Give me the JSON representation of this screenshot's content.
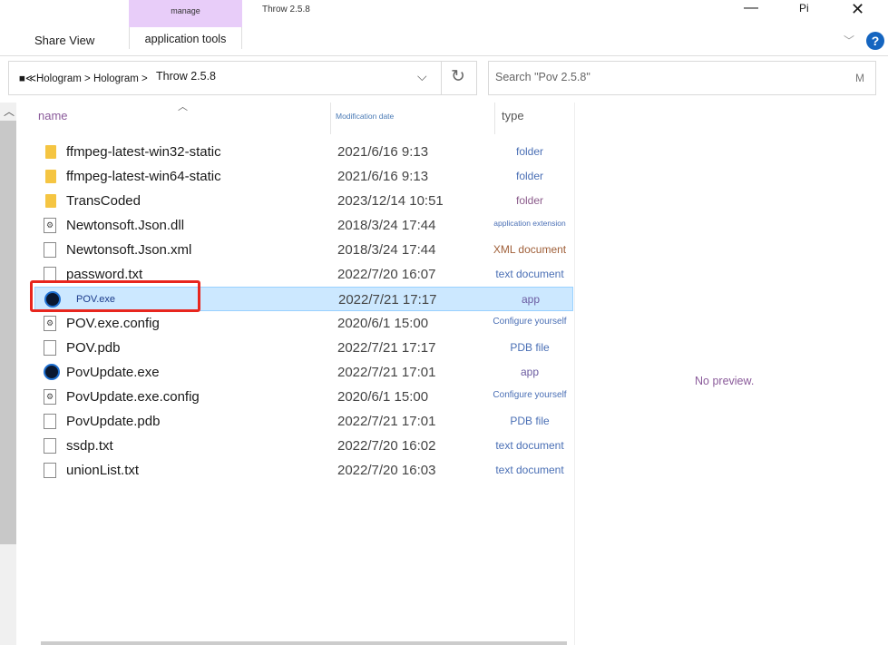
{
  "ribbon": {
    "manage_label": "manage",
    "title": "Throw 2.5.8",
    "share_view_label": "Share View",
    "app_tools_label": "application tools",
    "pi_label": "Pi"
  },
  "address": {
    "path": "■≪Hologram > Hologram >",
    "current": "Throw 2.5.8"
  },
  "search": {
    "placeholder": "Search \"Pov 2.5.8\"",
    "suffix": "M"
  },
  "columns": {
    "name": "name",
    "date": "Modification date",
    "type": "type"
  },
  "files": [
    {
      "name": "ffmpeg-latest-win32-static",
      "date": "2021/6/16 9:13",
      "type": "folder",
      "icon": "folder",
      "type_color": "#4a6fb5"
    },
    {
      "name": "ffmpeg-latest-win64-static",
      "date": "2021/6/16 9:13",
      "type": "folder",
      "icon": "folder",
      "type_color": "#4a6fb5"
    },
    {
      "name": "TransCoded",
      "date": "2023/12/14 10:51",
      "type": "folder",
      "icon": "folder",
      "type_color": "#8a5a8a"
    },
    {
      "name": "Newtonsoft.Json.dll",
      "date": "2018/3/24 17:44",
      "type": "application extension",
      "icon": "dll",
      "type_color": "#4a6fb5"
    },
    {
      "name": "Newtonsoft.Json.xml",
      "date": "2018/3/24 17:44",
      "type": "XML document",
      "icon": "xml",
      "type_color": "#a0603a"
    },
    {
      "name": "password.txt",
      "date": "2022/7/20 16:07",
      "type": "text document",
      "icon": "text",
      "type_color": "#4a6fb5"
    },
    {
      "name": "POV.exe",
      "date": "2022/7/21 17:17",
      "type": "app",
      "icon": "exe",
      "type_color": "#6a5aa0",
      "selected": true
    },
    {
      "name": "POV.exe.config",
      "date": "2020/6/1 15:00",
      "type": "Configure yourself",
      "icon": "config",
      "type_color": "#4a6fb5"
    },
    {
      "name": "POV.pdb",
      "date": "2022/7/21 17:17",
      "type": "PDB file",
      "icon": "text",
      "type_color": "#4a6fb5"
    },
    {
      "name": "PovUpdate.exe",
      "date": "2022/7/21 17:01",
      "type": "app",
      "icon": "exe",
      "type_color": "#6a5aa0"
    },
    {
      "name": "PovUpdate.exe.config",
      "date": "2020/6/1 15:00",
      "type": "Configure yourself",
      "icon": "config",
      "type_color": "#4a6fb5"
    },
    {
      "name": "PovUpdate.pdb",
      "date": "2022/7/21 17:01",
      "type": "PDB file",
      "icon": "text",
      "type_color": "#4a6fb5"
    },
    {
      "name": "ssdp.txt",
      "date": "2022/7/20 16:02",
      "type": "text document",
      "icon": "text",
      "type_color": "#4a6fb5"
    },
    {
      "name": "unionList.txt",
      "date": "2022/7/20 16:03",
      "type": "text document",
      "icon": "text",
      "type_color": "#4a6fb5"
    }
  ],
  "preview": {
    "text": "No preview."
  },
  "colors": {
    "highlight": "#e8261e",
    "selection": "#cce8ff",
    "manage_tab": "#e8cdf9"
  }
}
